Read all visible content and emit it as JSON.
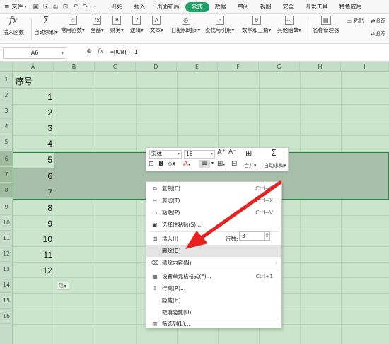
{
  "menubar": {
    "file_label": "文件",
    "tabs": [
      {
        "label": "开始"
      },
      {
        "label": "插入"
      },
      {
        "label": "页面布局"
      },
      {
        "label": "公式"
      },
      {
        "label": "数据"
      },
      {
        "label": "审阅"
      },
      {
        "label": "视图"
      },
      {
        "label": "安全"
      },
      {
        "label": "开发工具"
      },
      {
        "label": "特色应用"
      }
    ],
    "active_tab": "公式",
    "accent_color": "#21a366"
  },
  "ribbon": {
    "items": [
      {
        "label": "插入函数",
        "icon": "fx-icon"
      },
      {
        "label": "自动求和",
        "icon": "sigma-icon"
      },
      {
        "label": "常用函数",
        "icon": "function-list-icon"
      },
      {
        "label": "全部",
        "icon": "all-functions-icon"
      },
      {
        "label": "财务",
        "icon": "finance-icon"
      },
      {
        "label": "逻辑",
        "icon": "logic-icon"
      },
      {
        "label": "文本",
        "icon": "text-icon"
      },
      {
        "label": "日期和时间",
        "icon": "datetime-icon"
      },
      {
        "label": "查找与引用",
        "icon": "lookup-icon"
      },
      {
        "label": "数学和三角",
        "icon": "math-icon"
      },
      {
        "label": "其他函数",
        "icon": "more-functions-icon"
      },
      {
        "label": "名称管理器",
        "icon": "name-manager-icon"
      }
    ],
    "paste_label": "粘贴",
    "trace_label_1": "追踪",
    "trace_label_2": "追踪"
  },
  "formula_bar": {
    "name_box": "A6",
    "fx_label": "fx",
    "formula": "=ROW()-1"
  },
  "grid": {
    "columns": [
      "A",
      "B",
      "C",
      "D",
      "E",
      "F",
      "G",
      "H",
      "I"
    ],
    "rows": [
      "1",
      "2",
      "3",
      "4",
      "5",
      "6",
      "7",
      "8",
      "9",
      "10",
      "11",
      "12",
      "13",
      "14",
      "15",
      "16"
    ],
    "header_cell": "序号",
    "values": [
      "1",
      "2",
      "3",
      "4",
      "5",
      "6",
      "7",
      "8",
      "9",
      "10",
      "11",
      "12"
    ],
    "background_color": "#cbe5cd",
    "selection_color": "#218a3d"
  },
  "mini_toolbar": {
    "font": "宋体",
    "size": "16",
    "merge_label": "合并",
    "autosum_label": "自动求和"
  },
  "context_menu": {
    "items": [
      {
        "label": "复制(C)",
        "shortcut": "Ctrl+C",
        "icon": "copy-icon"
      },
      {
        "label": "剪切(T)",
        "shortcut": "Ctrl+X",
        "icon": "cut-icon"
      },
      {
        "label": "粘贴(P)",
        "shortcut": "Ctrl+V",
        "icon": "paste-icon"
      },
      {
        "label": "选择性粘贴(S)...",
        "shortcut": "",
        "icon": "paste-special-icon"
      },
      {
        "label": "插入(I)",
        "shortcut": "",
        "icon": "insert-icon"
      },
      {
        "label": "删除(D)",
        "shortcut": "",
        "icon": ""
      },
      {
        "label": "清除内容(N)",
        "shortcut": "",
        "icon": "clear-icon"
      },
      {
        "label": "设置单元格格式(F)...",
        "shortcut": "Ctrl+1",
        "icon": "format-cells-icon"
      },
      {
        "label": "行高(R)...",
        "shortcut": "",
        "icon": "row-height-icon"
      },
      {
        "label": "隐藏(H)",
        "shortcut": "",
        "icon": ""
      },
      {
        "label": "取消隐藏(U)",
        "shortcut": "",
        "icon": ""
      },
      {
        "label": "筛选列(L)...",
        "shortcut": "",
        "icon": "filter-column-icon"
      }
    ],
    "rows_label": "行数:",
    "rows_value": "3",
    "highlighted_item": "删除(D)"
  },
  "annotation": {
    "arrow_color": "#e8201e"
  }
}
